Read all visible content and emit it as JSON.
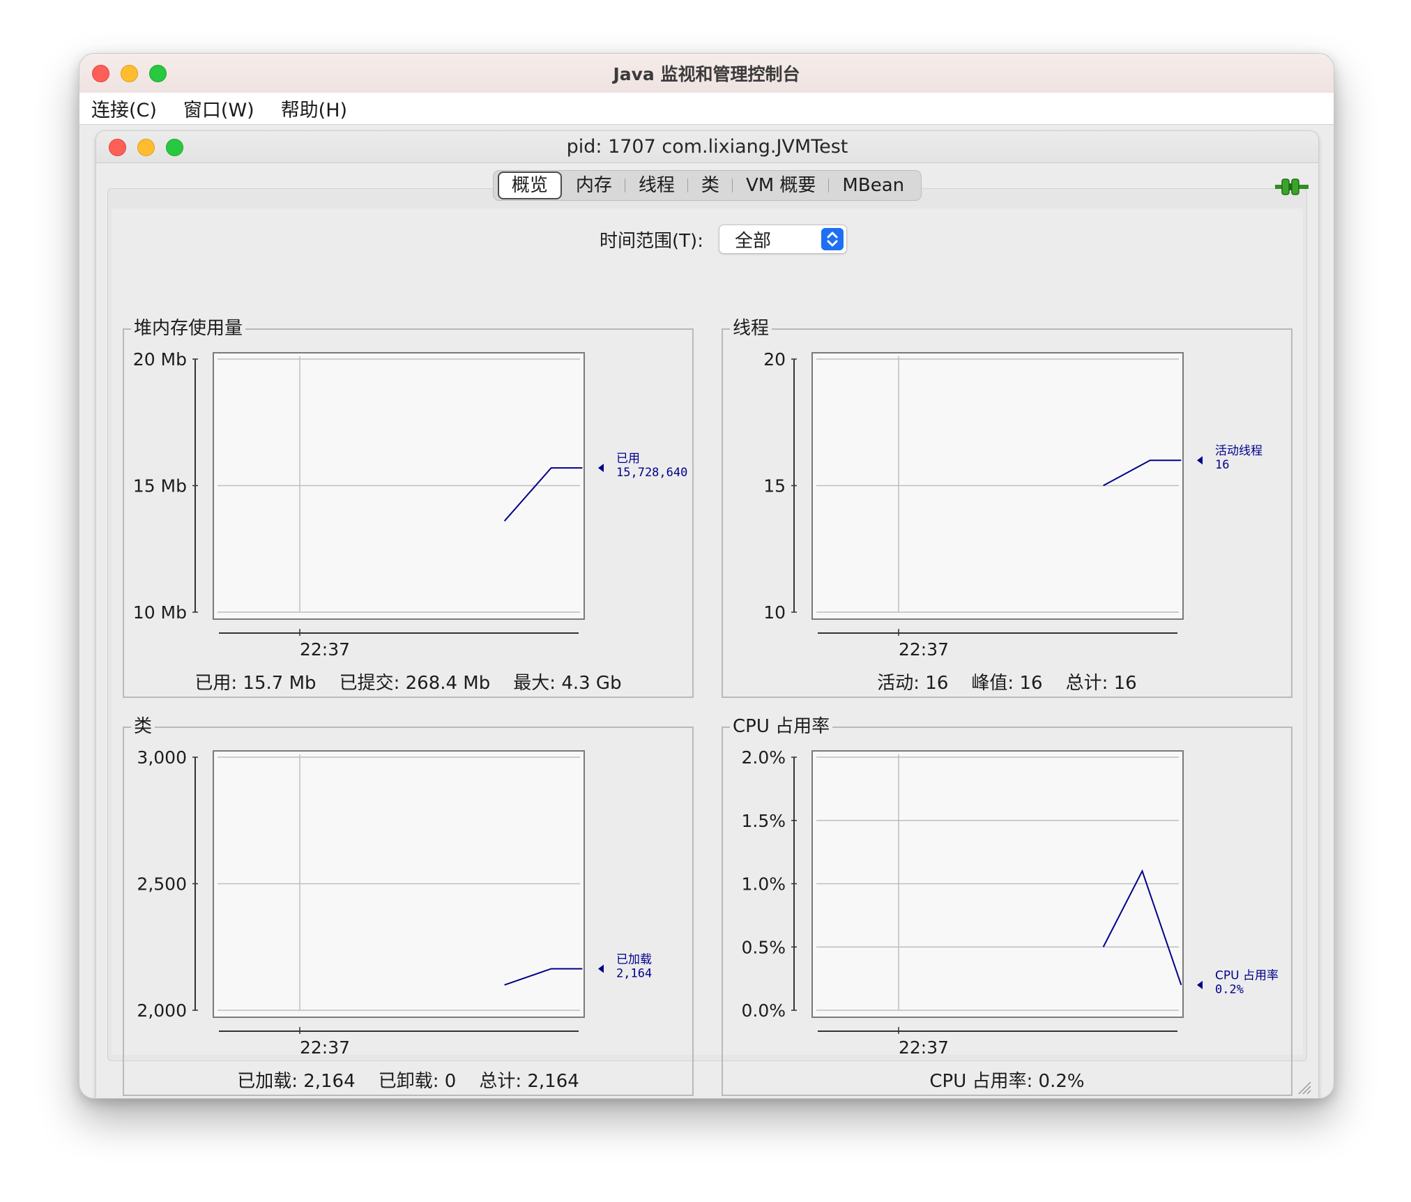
{
  "window": {
    "title": "Java 监视和管理控制台"
  },
  "menu": [
    "连接(C)",
    "窗口(W)",
    "帮助(H)"
  ],
  "inner_window": {
    "title": "pid: 1707 com.lixiang.JVMTest"
  },
  "tabs": [
    {
      "label": "概览",
      "active": true
    },
    {
      "label": "内存",
      "active": false
    },
    {
      "label": "线程",
      "active": false
    },
    {
      "label": "类",
      "active": false
    },
    {
      "label": "VM 概要",
      "active": false
    },
    {
      "label": "MBean",
      "active": false
    }
  ],
  "time_range": {
    "label": "时间范围(T):",
    "value": "全部"
  },
  "colors": {
    "line": "#00008b",
    "grid": "#bdbdbd",
    "plot_bg": "#f8f8f8"
  },
  "panels": {
    "heap": {
      "title": "堆内存使用量",
      "summary": "已用: 15.7 Mb    已提交: 268.4 Mb    最大: 4.3 Gb",
      "legend_name": "已用",
      "legend_value": "15,728,640",
      "y_ticks": [
        "20 Mb",
        "15 Mb",
        "10 Mb"
      ],
      "x_tick": "22:37"
    },
    "threads": {
      "title": "线程",
      "summary": "活动: 16    峰值: 16    总计: 16",
      "legend_name": "活动线程",
      "legend_value": "16",
      "y_ticks": [
        "20",
        "15",
        "10"
      ],
      "x_tick": "22:37"
    },
    "classes": {
      "title": "类",
      "summary": "已加载: 2,164    已卸载: 0    总计: 2,164",
      "legend_name": "已加载",
      "legend_value": "2,164",
      "y_ticks": [
        "3,000",
        "2,500",
        "2,000"
      ],
      "x_tick": "22:37"
    },
    "cpu": {
      "title": "CPU 占用率",
      "summary": "CPU 占用率: 0.2%",
      "legend_name": "CPU 占用率",
      "legend_value": "0.2%",
      "y_ticks": [
        "2.0%",
        "1.5%",
        "1.0%",
        "0.5%",
        "0.0%"
      ],
      "x_tick": "22:37"
    }
  },
  "chart_data": [
    {
      "type": "line",
      "title": "堆内存使用量",
      "series": [
        {
          "name": "已用",
          "unit": "Mb",
          "values": [
            13.6,
            15.7,
            15.7
          ]
        }
      ],
      "ylim": [
        10,
        20
      ],
      "x_tick": "22:37"
    },
    {
      "type": "line",
      "title": "线程",
      "series": [
        {
          "name": "活动线程",
          "values": [
            15,
            16,
            16
          ]
        }
      ],
      "ylim": [
        10,
        20
      ],
      "x_tick": "22:37"
    },
    {
      "type": "line",
      "title": "类",
      "series": [
        {
          "name": "已加载",
          "values": [
            2100,
            2164,
            2164
          ]
        }
      ],
      "ylim": [
        2000,
        3000
      ],
      "x_tick": "22:37"
    },
    {
      "type": "line",
      "title": "CPU 占用率",
      "series": [
        {
          "name": "CPU 占用率",
          "unit": "%",
          "values": [
            0.5,
            1.1,
            0.2
          ]
        }
      ],
      "ylim": [
        0.0,
        2.0
      ],
      "x_tick": "22:37"
    }
  ]
}
